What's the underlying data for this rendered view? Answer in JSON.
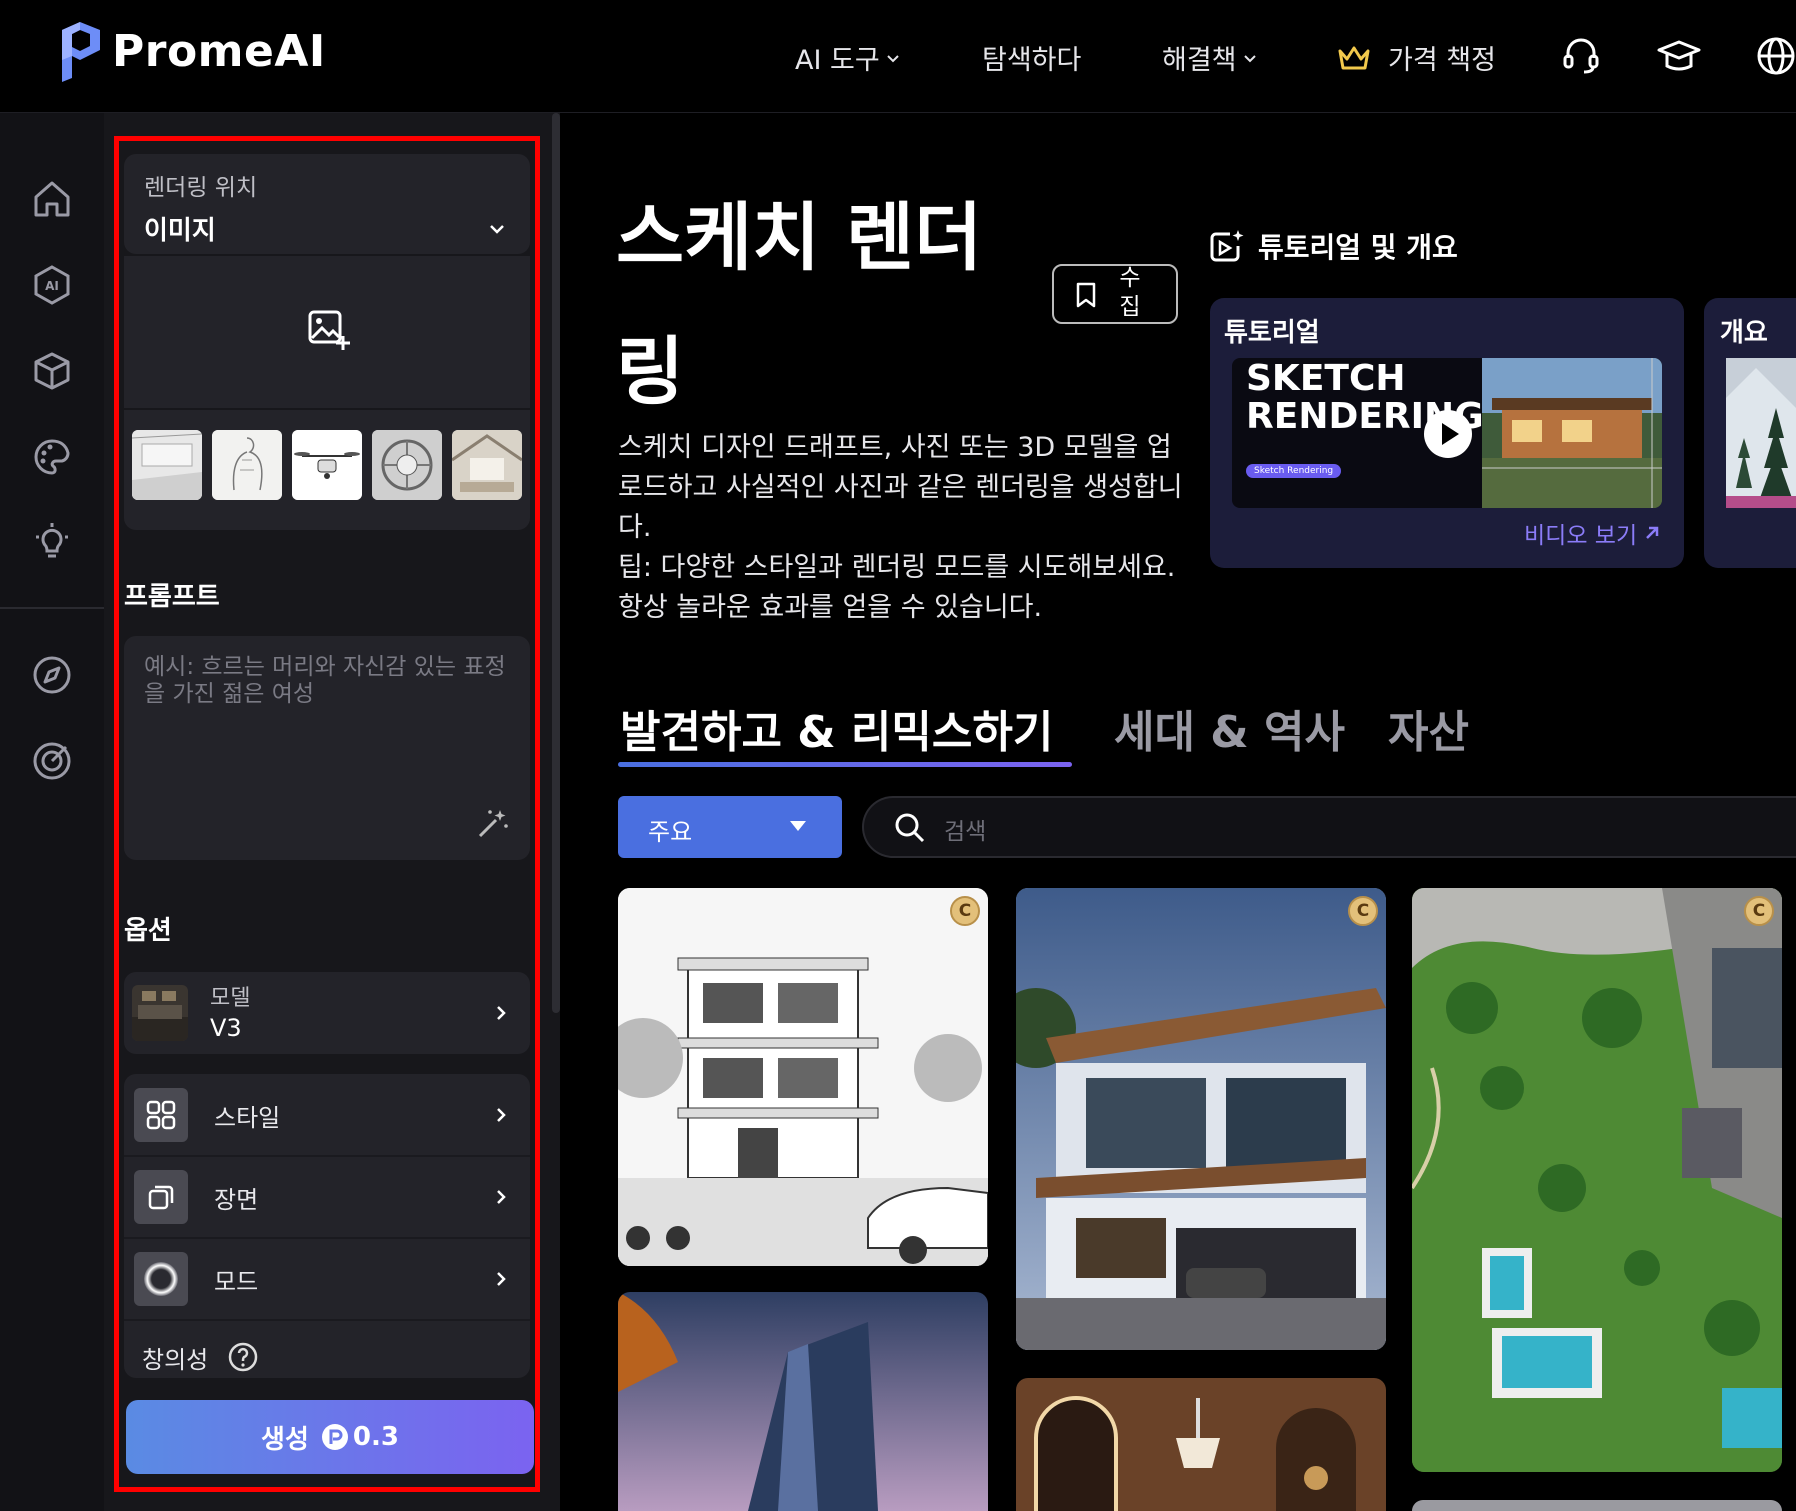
{
  "brand": {
    "name": "PromeAI"
  },
  "nav": {
    "ai_tools": "AI 도구",
    "explore": "탐색하다",
    "solutions": "해결책",
    "pricing": "가격 책정"
  },
  "panel": {
    "render_location_label": "렌더링 위치",
    "render_location_value": "이미지",
    "prompt_heading": "프롬프트",
    "prompt_placeholder": "예시: 흐르는 머리와 자신감 있는 표정을 가진 젊은 여성",
    "options_heading": "옵션",
    "model_label": "모델",
    "model_value": "V3",
    "style_label": "스타일",
    "scene_label": "장면",
    "mode_label": "모드",
    "creativity_label": "창의성",
    "generate_label": "생성",
    "generate_cost": "0.3"
  },
  "main": {
    "title_line1": "스케치 렌더",
    "title_line2": "링",
    "collect_label": "수집",
    "description": "스케치 디자인 드래프트, 사진 또는 3D 모델을 업로드하고 사실적인 사진과 같은 렌더링을 생성합니다.",
    "tip": "팁: 다양한 스타일과 렌더링 모드를 시도해보세요. 항상 놀라운 효과를 얻을 수 있습니다.",
    "tutorial_section_title": "튜토리얼 및 개요",
    "tutorial_card_label": "튜토리얼",
    "tutorial_video_title": "SKETCH RENDERING",
    "tutorial_video_badge": "Sketch Rendering",
    "watch_video": "비디오 보기",
    "overview_card_label": "개요",
    "tabs": [
      "발견하고 & 리믹스하기",
      "세대 & 역사",
      "자산"
    ],
    "filter_value": "주요",
    "search_placeholder": "검색",
    "copyright_symbol": "C"
  },
  "colors": {
    "accent_blue": "#4a6fe0",
    "tab_underline": "#7b63f0",
    "crown_yellow": "#f2c94c",
    "highlight_red": "#ff0000"
  }
}
